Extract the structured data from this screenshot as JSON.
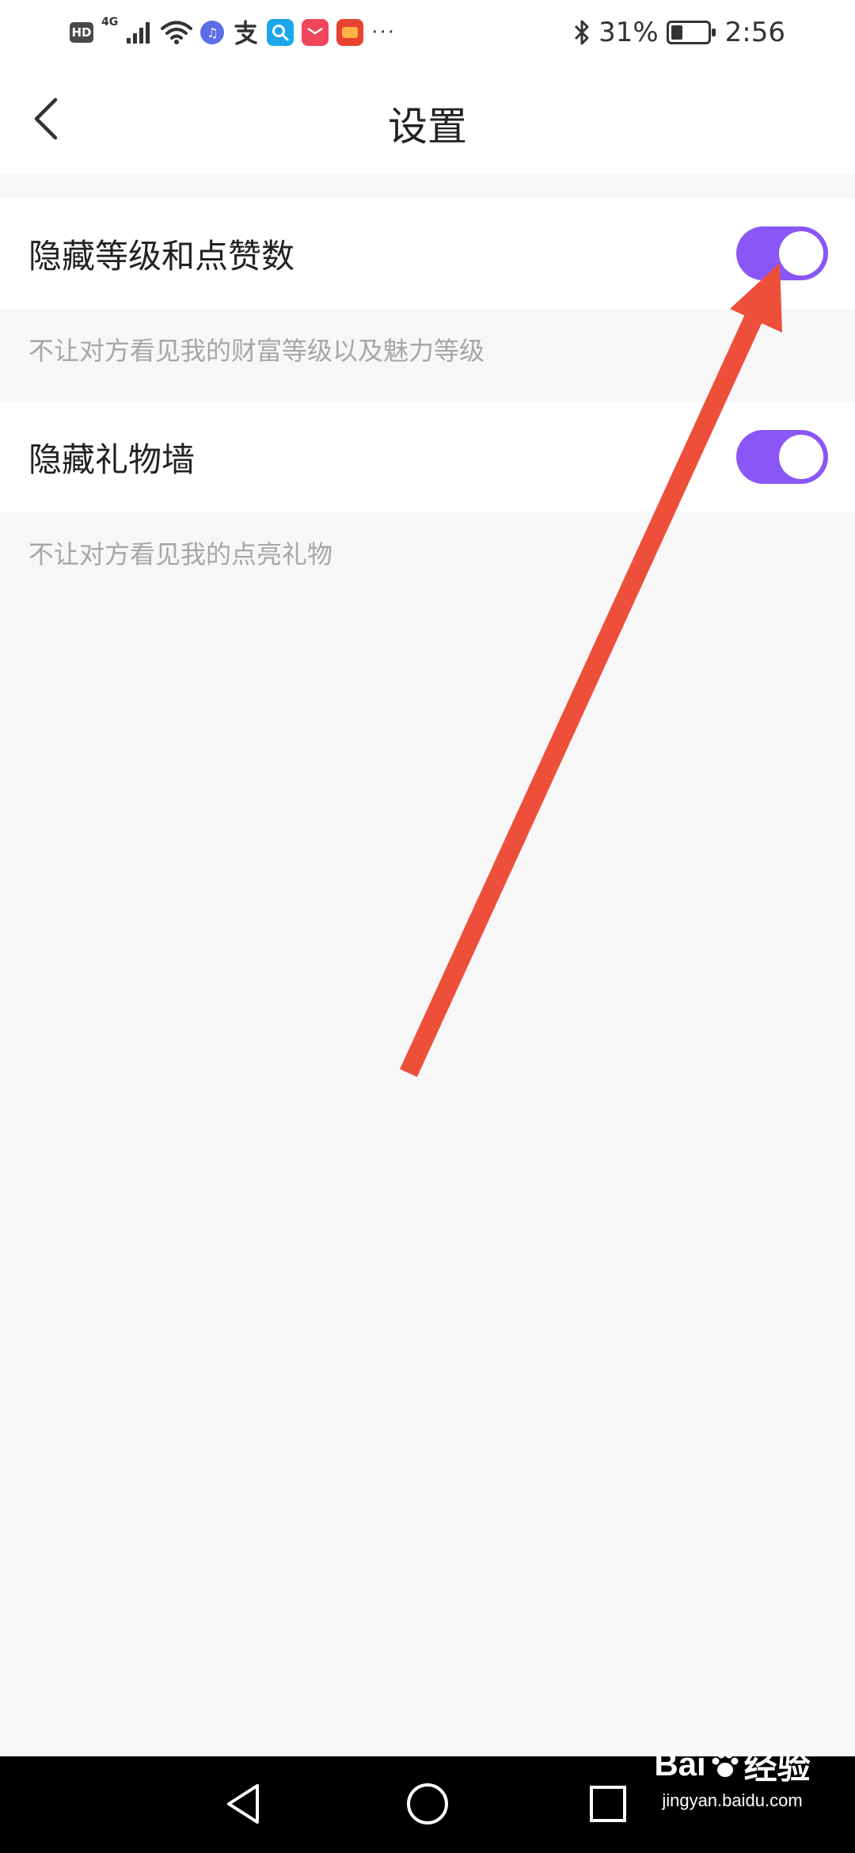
{
  "status_bar": {
    "hd_label": "HD",
    "network_label": "4G",
    "left_icons": [
      "signal-icon",
      "wifi-icon",
      "music-app-icon",
      "alipay-icon",
      "search-app-icon",
      "huawei-app-icon",
      "huawei-video-app-icon"
    ],
    "more_label": "···",
    "battery_percent": "31%",
    "battery_level": 0.31,
    "time": "2:56"
  },
  "header": {
    "back_icon": "chevron-left-icon",
    "title": "设置"
  },
  "settings": [
    {
      "label": "隐藏等级和点赞数",
      "enabled": true,
      "description": "不让对方看见我的财富等级以及魅力等级"
    },
    {
      "label": "隐藏礼物墙",
      "enabled": true,
      "description": "不让对方看见我的点亮礼物"
    }
  ],
  "colors": {
    "toggle_on": "#8a56f6",
    "arrow": "#ee4f3b",
    "description_text": "#a6a6a6",
    "page_background": "#f7f7f7"
  },
  "nav_bar": {
    "icons": [
      "back-triangle-icon",
      "home-circle-icon",
      "recents-square-icon"
    ]
  },
  "watermark": {
    "brand_prefix": "Bai",
    "brand_suffix": "经验",
    "site": "jingyan.baidu.com"
  }
}
